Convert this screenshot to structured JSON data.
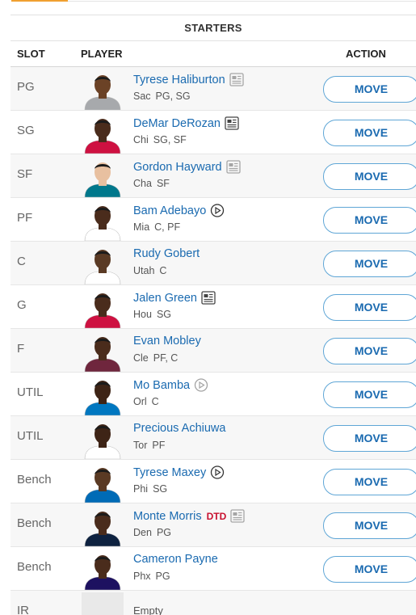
{
  "roster": {
    "section_title": "STARTERS",
    "columns": {
      "slot": "SLOT",
      "player": "PLAYER",
      "action": "ACTION"
    },
    "rows": [
      {
        "slot": "PG",
        "name": "Tyrese Haliburton",
        "team": "Sac",
        "positions": "PG, SG",
        "icon": "news-icon",
        "icon_dim": true,
        "status": "",
        "action": "MOVE",
        "jersey": "#a7a9ac",
        "skin": "#6b4226"
      },
      {
        "slot": "SG",
        "name": "DeMar DeRozan",
        "team": "Chi",
        "positions": "SG, SF",
        "icon": "news-icon",
        "icon_dim": false,
        "status": "",
        "action": "MOVE",
        "jersey": "#ce1141",
        "skin": "#4a2c1c"
      },
      {
        "slot": "SF",
        "name": "Gordon Hayward",
        "team": "Cha",
        "positions": "SF",
        "icon": "news-icon",
        "icon_dim": true,
        "status": "",
        "action": "MOVE",
        "jersey": "#00788c",
        "skin": "#e8c0a0"
      },
      {
        "slot": "PF",
        "name": "Bam Adebayo",
        "team": "Mia",
        "positions": "C, PF",
        "icon": "video-icon",
        "icon_dim": false,
        "status": "",
        "action": "MOVE",
        "jersey": "#ffffff",
        "skin": "#4a2c1c"
      },
      {
        "slot": "C",
        "name": "Rudy Gobert",
        "team": "Utah",
        "positions": "C",
        "icon": "",
        "icon_dim": false,
        "status": "",
        "action": "MOVE",
        "jersey": "#ffffff",
        "skin": "#5a3a24"
      },
      {
        "slot": "G",
        "name": "Jalen Green",
        "team": "Hou",
        "positions": "SG",
        "icon": "news-icon",
        "icon_dim": false,
        "status": "",
        "action": "MOVE",
        "jersey": "#ce1141",
        "skin": "#4a2c1c"
      },
      {
        "slot": "F",
        "name": "Evan Mobley",
        "team": "Cle",
        "positions": "PF, C",
        "icon": "",
        "icon_dim": false,
        "status": "",
        "action": "MOVE",
        "jersey": "#6f263d",
        "skin": "#4a2c1c"
      },
      {
        "slot": "UTIL",
        "name": "Mo Bamba",
        "team": "Orl",
        "positions": "C",
        "icon": "video-icon",
        "icon_dim": true,
        "status": "",
        "action": "MOVE",
        "jersey": "#0077c0",
        "skin": "#3e2416"
      },
      {
        "slot": "UTIL",
        "name": "Precious Achiuwa",
        "team": "Tor",
        "positions": "PF",
        "icon": "",
        "icon_dim": false,
        "status": "",
        "action": "MOVE",
        "jersey": "#ffffff",
        "skin": "#3e2416"
      },
      {
        "slot": "Bench",
        "name": "Tyrese Maxey",
        "team": "Phi",
        "positions": "SG",
        "icon": "video-icon",
        "icon_dim": false,
        "status": "",
        "action": "MOVE",
        "jersey": "#006bb6",
        "skin": "#5a3a24"
      },
      {
        "slot": "Bench",
        "name": "Monte Morris",
        "team": "Den",
        "positions": "PG",
        "icon": "news-icon",
        "icon_dim": true,
        "status": "DTD",
        "action": "MOVE",
        "jersey": "#0e2240",
        "skin": "#4a2c1c"
      },
      {
        "slot": "Bench",
        "name": "Cameron Payne",
        "team": "Phx",
        "positions": "PG",
        "icon": "",
        "icon_dim": false,
        "status": "",
        "action": "MOVE",
        "jersey": "#1d1160",
        "skin": "#4a2c1c"
      }
    ],
    "partial_row": {
      "slot": "IR",
      "name": "Empty"
    }
  },
  "colors": {
    "accent": "#f0a030",
    "link": "#1a6ab0",
    "button_border": "#5fa6d6",
    "status_dtd": "#c8102e"
  }
}
